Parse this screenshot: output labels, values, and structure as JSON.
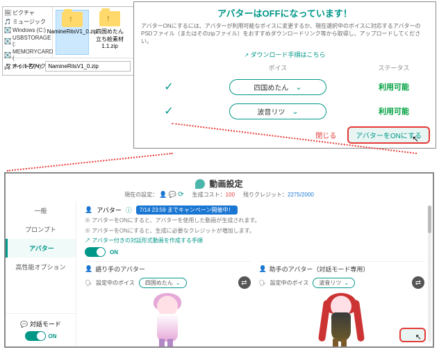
{
  "explorer": {
    "tree": [
      {
        "icon": "image",
        "label": "ピクチャ"
      },
      {
        "icon": "music",
        "label": "ミュージック"
      },
      {
        "icon": "disk",
        "label": "Windows (C:)"
      },
      {
        "icon": "disk",
        "label": "USBSTORAGE (:"
      },
      {
        "icon": "disk",
        "label": "MEMORYCARD ("
      },
      {
        "icon": "net",
        "label": "ネットワーク"
      }
    ],
    "files": [
      {
        "name": "NamineRitsV1_0.zip",
        "selected": true
      },
      {
        "name": "四国めたん立ち絵素材1.1.zip",
        "selected": false
      }
    ],
    "filename_label": "ファイル名(N):",
    "filename_value": "NamineRitsV1_0.zip"
  },
  "modal": {
    "title": "アバターはOFFになっています！",
    "desc": "アバターONにするには、アバターが利用可能なボイスに変更するか、現在選択中のボイスに対応するアバターのPSDファイル（またはそのzipファイル）をおすすめダウンロードリンク等から取得し、アップロードしてください。",
    "link": "ダウンロード手順はこちら",
    "head_voice": "ボイス",
    "head_status": "ステータス",
    "rows": [
      {
        "voice": "四国めたん",
        "status": "利用可能"
      },
      {
        "voice": "波音リツ",
        "status": "利用可能"
      }
    ],
    "close": "閉じる",
    "turn_on": "アバターをONにする"
  },
  "panel": {
    "title": "動画設定",
    "current_label": "現在の設定：",
    "cost_label": "生成コスト：",
    "cost_value": "100",
    "credit_label": "残りクレジット：",
    "credit_value": "2275/2000",
    "side": {
      "items": [
        "一般",
        "プロンプト",
        "アバター",
        "高性能オプション"
      ],
      "active_index": 2,
      "dialog_label": "対話モード",
      "dialog_on": "ON"
    },
    "avatar_section": {
      "label": "アバター",
      "campaign": "7/14 23:59 までキャンペーン開催中！",
      "note1": "※ アバターをONにすると、アバターを使用した動画が生成されます。",
      "note2": "※ アバターをONにすると、生成に必要なクレジットが増加します。",
      "guide": "アバター付きの対話形式動画を作成する手順",
      "on": "ON"
    },
    "left_avatar": {
      "title": "語り手のアバター",
      "voice_label": "設定中のボイス",
      "voice": "四国めたん"
    },
    "right_avatar": {
      "title": "助手のアバター（対話モード専用）",
      "voice_label": "設定中のボイス",
      "voice": "波音リツ"
    }
  }
}
